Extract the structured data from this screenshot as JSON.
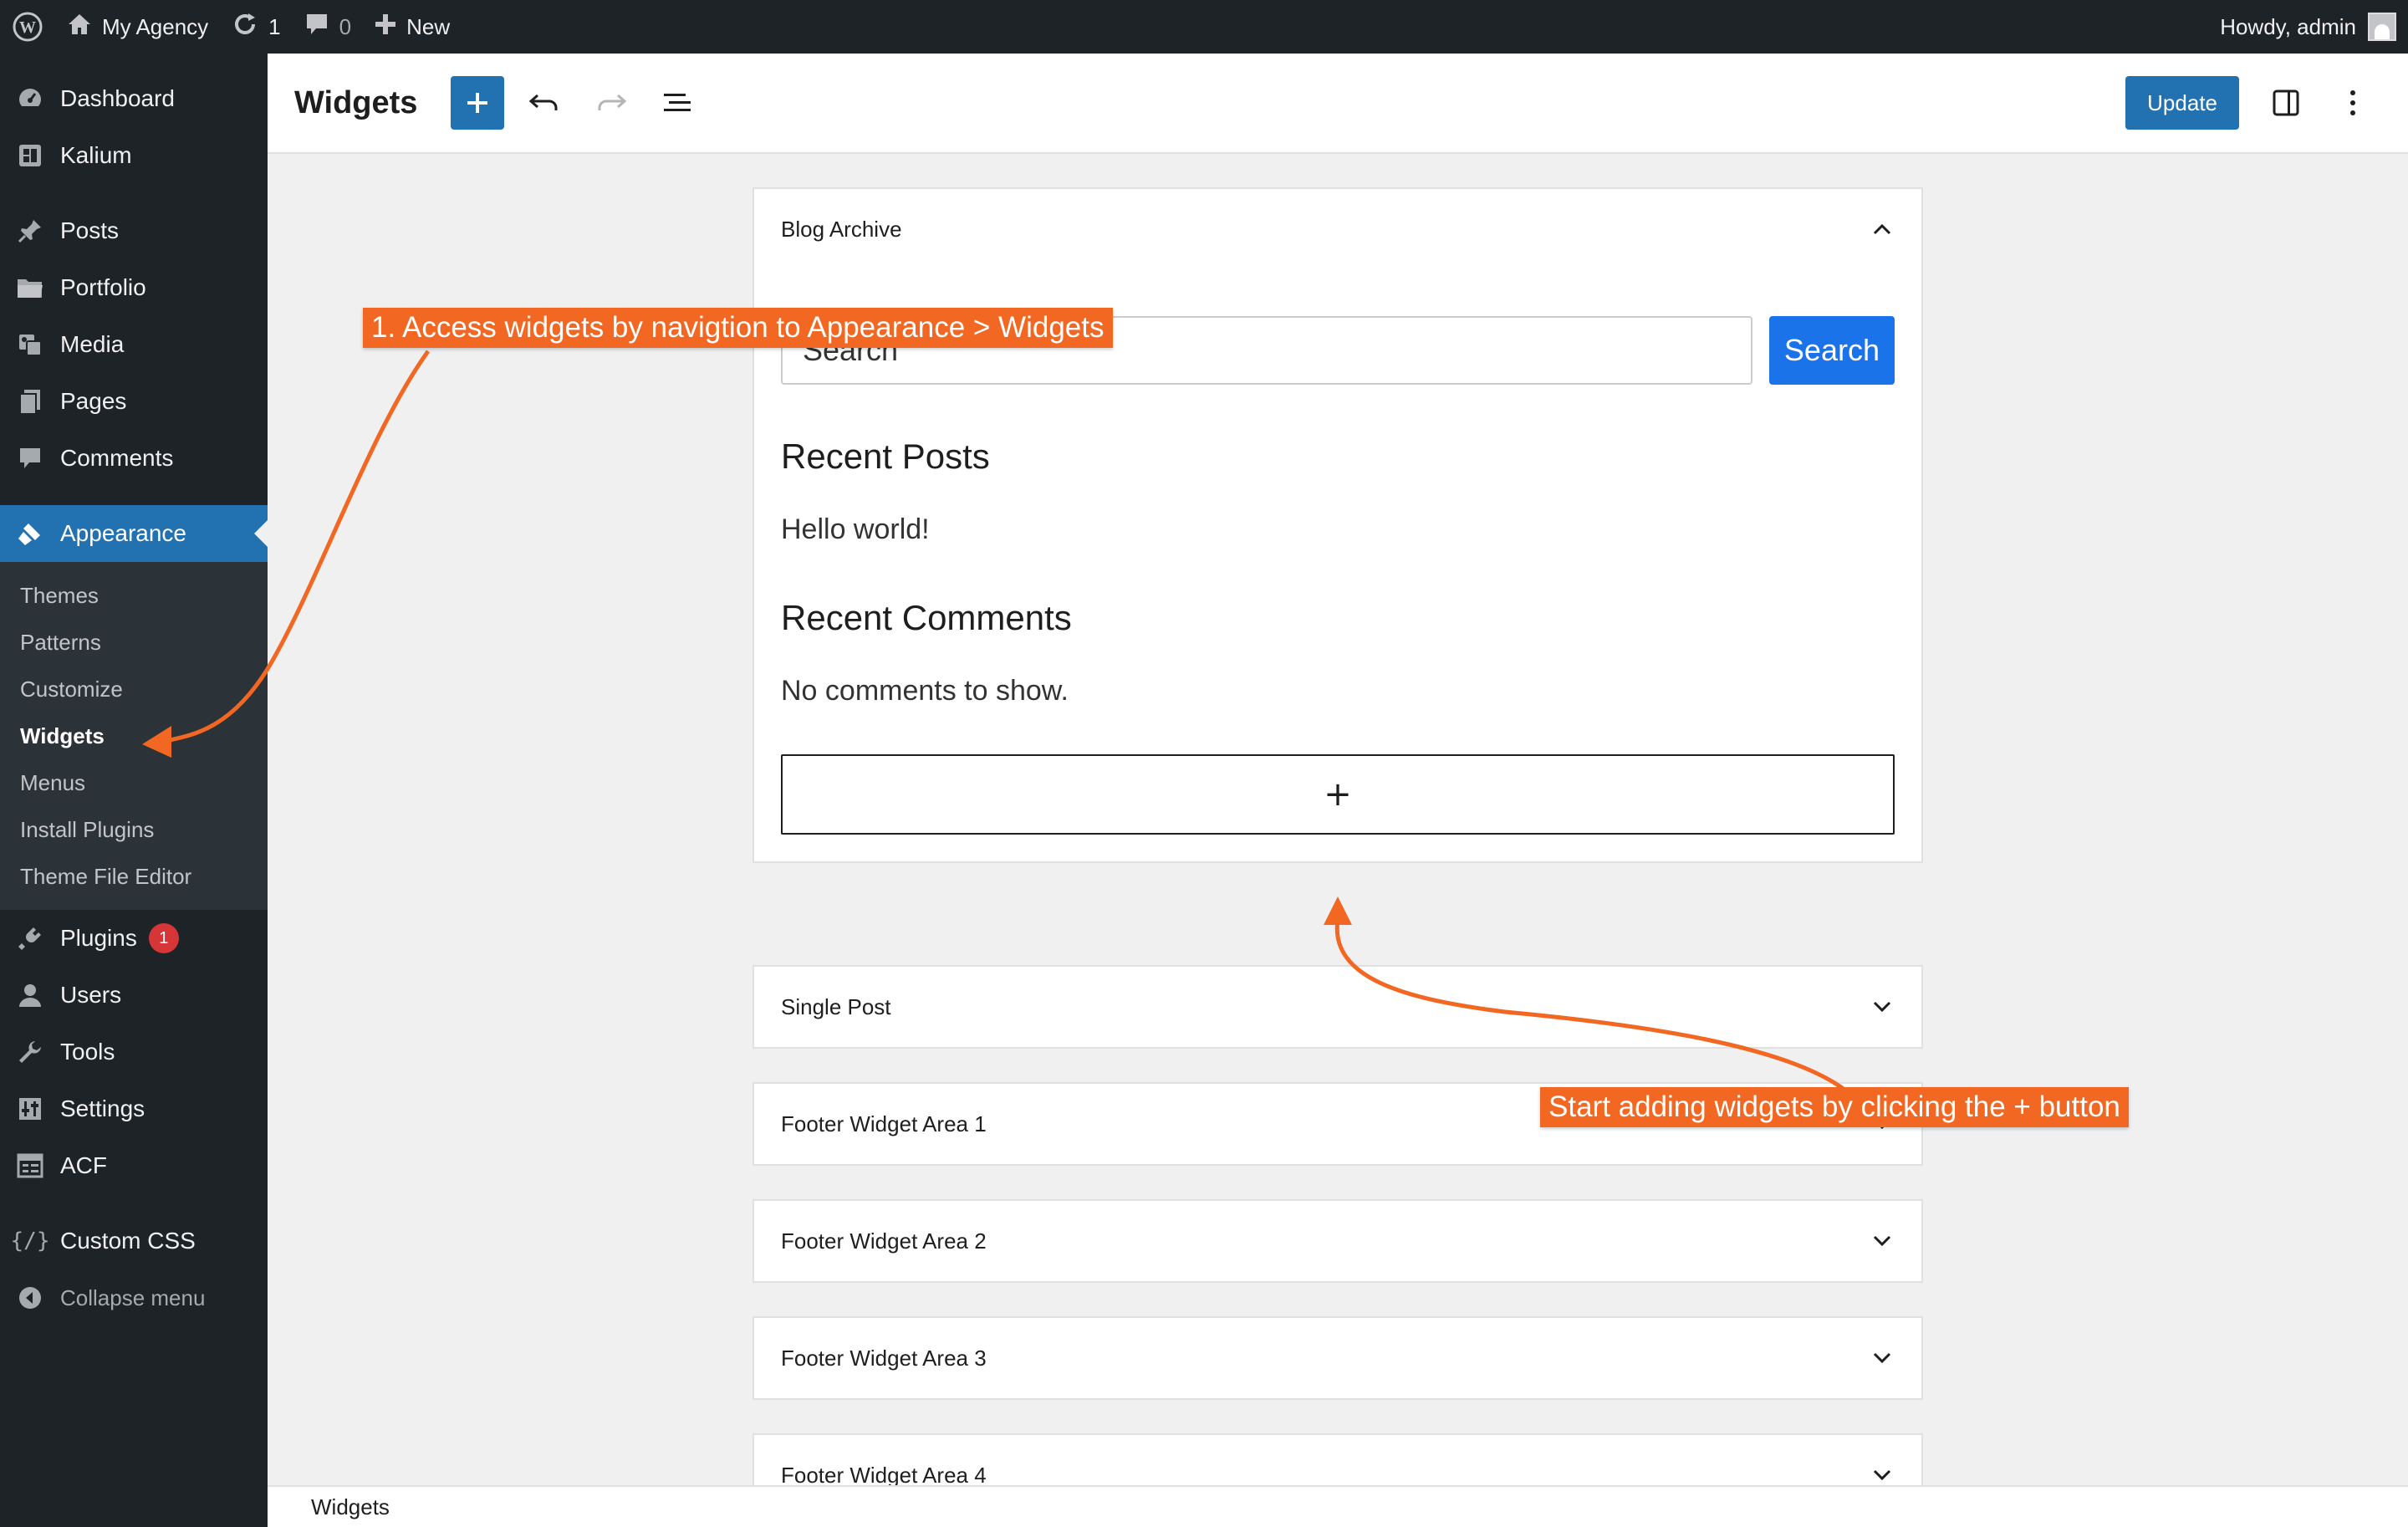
{
  "admin_bar": {
    "site_name": "My Agency",
    "updates_count": "1",
    "comments_count": "0",
    "new_label": "New",
    "howdy": "Howdy, admin"
  },
  "sidebar": {
    "top_items": [
      {
        "label": "Dashboard",
        "icon": "dashboard-icon"
      },
      {
        "label": "Kalium",
        "icon": "kalium-icon"
      }
    ],
    "main_items": [
      {
        "label": "Posts",
        "icon": "pin-icon"
      },
      {
        "label": "Portfolio",
        "icon": "folder-icon"
      },
      {
        "label": "Media",
        "icon": "media-icon"
      },
      {
        "label": "Pages",
        "icon": "pages-icon"
      },
      {
        "label": "Comments",
        "icon": "comment-icon"
      }
    ],
    "current": {
      "label": "Appearance",
      "icon": "brush-icon"
    },
    "submenu": [
      "Themes",
      "Patterns",
      "Customize",
      "Widgets",
      "Menus",
      "Install Plugins",
      "Theme File Editor"
    ],
    "submenu_current": "Widgets",
    "lower_items": [
      {
        "label": "Plugins",
        "icon": "plugin-icon",
        "badge": "1"
      },
      {
        "label": "Users",
        "icon": "users-icon"
      },
      {
        "label": "Tools",
        "icon": "wrench-icon"
      },
      {
        "label": "Settings",
        "icon": "settings-icon"
      },
      {
        "label": "ACF",
        "icon": "acf-icon"
      }
    ],
    "custom_css": "Custom CSS",
    "collapse": "Collapse menu"
  },
  "header": {
    "title": "Widgets",
    "update_label": "Update"
  },
  "widget_areas": {
    "expanded": {
      "title": "Blog Archive",
      "search_placeholder": "Search",
      "search_button": "Search",
      "recent_posts_title": "Recent Posts",
      "recent_post_item": "Hello world!",
      "recent_comments_title": "Recent Comments",
      "no_comments": "No comments to show.",
      "add_block_symbol": "+"
    },
    "collapsed": [
      "Single Post",
      "Footer Widget Area 1",
      "Footer Widget Area 2",
      "Footer Widget Area 3",
      "Footer Widget Area 4"
    ]
  },
  "footer": {
    "breadcrumb": "Widgets"
  },
  "annotations": {
    "note1": "1. Access widgets by navigtion to Appearance > Widgets",
    "note2": "Start adding widgets by clicking the + button",
    "color": "#f26722"
  },
  "colors": {
    "admin_dark": "#1d2327",
    "accent_blue": "#2271b1",
    "search_blue": "#1a73e8",
    "badge_red": "#d63638"
  }
}
